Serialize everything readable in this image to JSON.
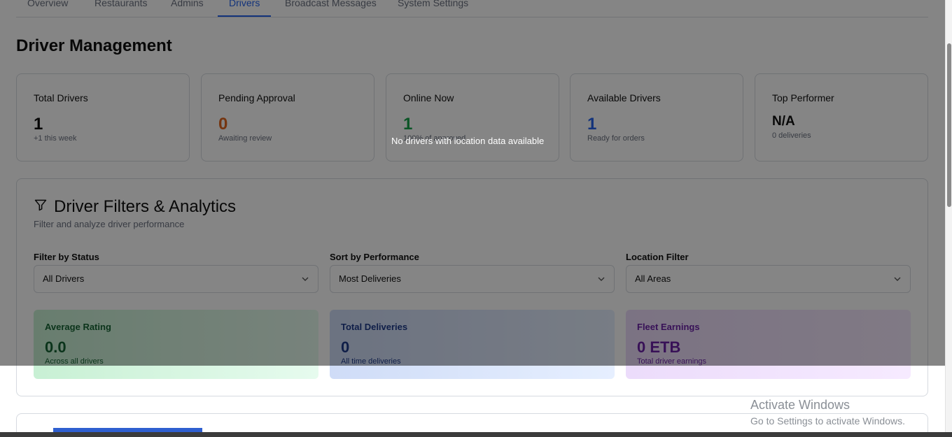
{
  "tabs": [
    {
      "label": "Overview",
      "active": false
    },
    {
      "label": "Restaurants",
      "active": false
    },
    {
      "label": "Admins",
      "active": false
    },
    {
      "label": "Drivers",
      "active": true
    },
    {
      "label": "Broadcast Messages",
      "active": false
    },
    {
      "label": "System Settings",
      "active": false
    }
  ],
  "page_title": "Driver Management",
  "stats": [
    {
      "label": "Total Drivers",
      "value": "1",
      "sub": "+1 this week",
      "color": "#111111"
    },
    {
      "label": "Pending Approval",
      "value": "0",
      "sub": "Awaiting review",
      "color": "#e0661f"
    },
    {
      "label": "Online Now",
      "value": "1",
      "sub": "100% of approved",
      "color": "#16a34a"
    },
    {
      "label": "Available Drivers",
      "value": "1",
      "sub": "Ready for orders",
      "color": "#2563eb"
    },
    {
      "label": "Top Performer",
      "value": "N/A",
      "sub": "0 deliveries",
      "color": "#111111"
    }
  ],
  "filters_panel": {
    "title": "Driver Filters & Analytics",
    "subtitle": "Filter and analyze driver performance",
    "icon": "filter-icon",
    "fields": [
      {
        "label": "Filter by Status",
        "value": "All Drivers"
      },
      {
        "label": "Sort by Performance",
        "value": "Most Deliveries"
      },
      {
        "label": "Location Filter",
        "value": "All Areas"
      }
    ],
    "metrics": [
      {
        "label": "Average Rating",
        "value": "0.0",
        "sub": "Across all drivers",
        "color": "#166534"
      },
      {
        "label": "Total Deliveries",
        "value": "0",
        "sub": "All time deliveries",
        "color": "#1e3a8a"
      },
      {
        "label": "Fleet Earnings",
        "value": "0 ETB",
        "sub": "Total driver earnings",
        "color": "#6b21a8"
      }
    ]
  },
  "overlay_message": "No drivers with location data available",
  "watermark": {
    "title": "Activate Windows",
    "subtitle": "Go to Settings to activate Windows."
  }
}
